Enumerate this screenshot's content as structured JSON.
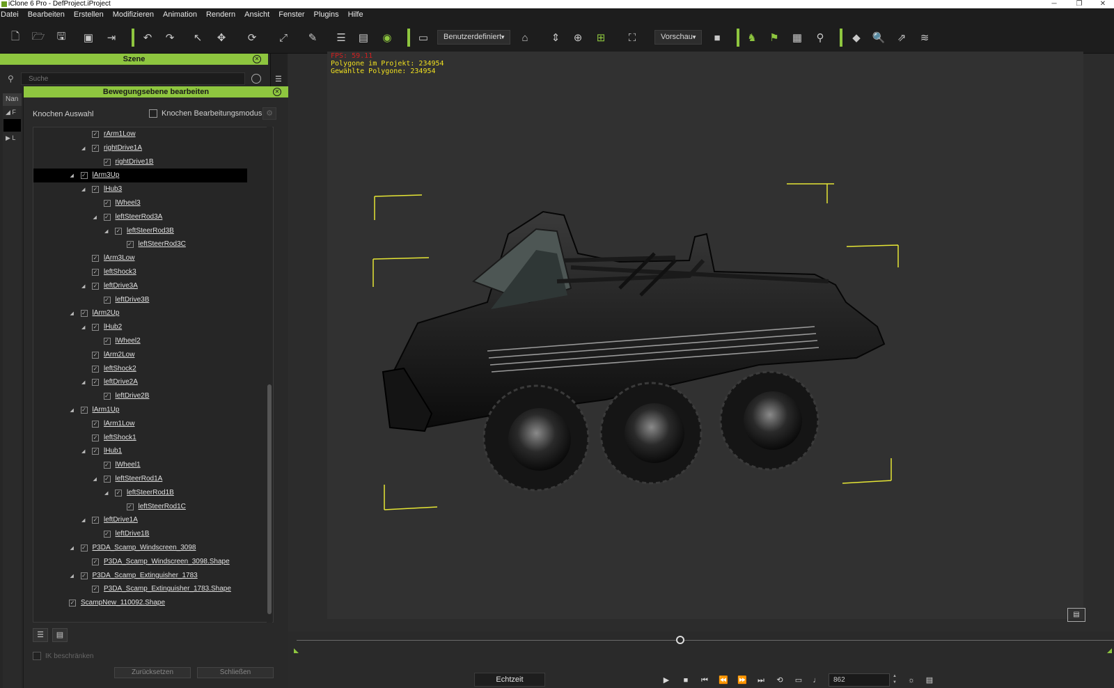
{
  "window": {
    "title": "iClone 6 Pro - DefProject.iProject",
    "min_glyph": "─",
    "max_glyph": "❐",
    "close_glyph": "✕"
  },
  "menu": [
    "Datei",
    "Bearbeiten",
    "Erstellen",
    "Modifizieren",
    "Animation",
    "Rendern",
    "Ansicht",
    "Fenster",
    "Plugins",
    "Hilfe"
  ],
  "toolbar": {
    "custom_dropdown": "Benutzerdefiniert",
    "preview_dropdown": "Vorschau",
    "accent": "#8ec63f"
  },
  "scene_panel": {
    "title": "Szene",
    "search_placeholder": "Suche",
    "column_header": "Nan",
    "row1": "◢  F",
    "row2": "▶  L"
  },
  "motion_panel": {
    "title": "Bewegungsebene bearbeiten",
    "bone_selection_label": "Knochen Auswahl",
    "bone_edit_mode_label": "Knochen Bearbeitungsmodus",
    "ik_label": "IK beschränken",
    "button1": "Zurücksetzen",
    "button2": "Schließen",
    "tree": [
      {
        "label": "rArm1Low",
        "level": 3,
        "expander": false
      },
      {
        "label": "rightDrive1A",
        "level": 3,
        "expander": true
      },
      {
        "label": "rightDrive1B",
        "level": 4,
        "expander": false
      },
      {
        "label": "lArm3Up",
        "level": 2,
        "expander": true,
        "selected": true
      },
      {
        "label": "lHub3",
        "level": 3,
        "expander": true
      },
      {
        "label": "lWheel3",
        "level": 4,
        "expander": false
      },
      {
        "label": "leftSteerRod3A",
        "level": 4,
        "expander": true
      },
      {
        "label": "leftSteerRod3B",
        "level": 5,
        "expander": true
      },
      {
        "label": "leftSteerRod3C",
        "level": 6,
        "expander": false
      },
      {
        "label": "lArm3Low",
        "level": 3,
        "expander": false
      },
      {
        "label": "leftShock3",
        "level": 3,
        "expander": false
      },
      {
        "label": "leftDrive3A",
        "level": 3,
        "expander": true
      },
      {
        "label": "leftDrive3B",
        "level": 4,
        "expander": false
      },
      {
        "label": "lArm2Up",
        "level": 2,
        "expander": true
      },
      {
        "label": "lHub2",
        "level": 3,
        "expander": true
      },
      {
        "label": "lWheel2",
        "level": 4,
        "expander": false
      },
      {
        "label": "lArm2Low",
        "level": 3,
        "expander": false
      },
      {
        "label": "leftShock2",
        "level": 3,
        "expander": false
      },
      {
        "label": "leftDrive2A",
        "level": 3,
        "expander": true
      },
      {
        "label": "leftDrive2B",
        "level": 4,
        "expander": false
      },
      {
        "label": "lArm1Up",
        "level": 2,
        "expander": true
      },
      {
        "label": "lArm1Low",
        "level": 3,
        "expander": false
      },
      {
        "label": "leftShock1",
        "level": 3,
        "expander": false
      },
      {
        "label": "lHub1",
        "level": 3,
        "expander": true
      },
      {
        "label": "lWheel1",
        "level": 4,
        "expander": false
      },
      {
        "label": "leftSteerRod1A",
        "level": 4,
        "expander": true
      },
      {
        "label": "leftSteerRod1B",
        "level": 5,
        "expander": true
      },
      {
        "label": "leftSteerRod1C",
        "level": 6,
        "expander": false
      },
      {
        "label": "leftDrive1A",
        "level": 3,
        "expander": true
      },
      {
        "label": "leftDrive1B",
        "level": 4,
        "expander": false
      },
      {
        "label": "P3DA_Scamp_Windscreen_3098",
        "level": 2,
        "expander": true
      },
      {
        "label": "P3DA_Scamp_Windscreen_3098.Shape",
        "level": 3,
        "expander": false
      },
      {
        "label": "P3DA_Scamp_Extinguisher_1783",
        "level": 2,
        "expander": true
      },
      {
        "label": "P3DA_Scamp_Extinguisher_1783.Shape",
        "level": 3,
        "expander": false
      },
      {
        "label": "ScampNew_110092.Shape",
        "level": 1,
        "expander": false
      }
    ]
  },
  "viewport": {
    "fps": "FPS: 59.11",
    "polygons_project": "Polygone im Projekt: 234954",
    "polygons_selected": "Gewählte Polygone: 234954"
  },
  "playback": {
    "realtime_label": "Echtzeit",
    "frame_value": "862",
    "timeline_position": 0.47
  }
}
